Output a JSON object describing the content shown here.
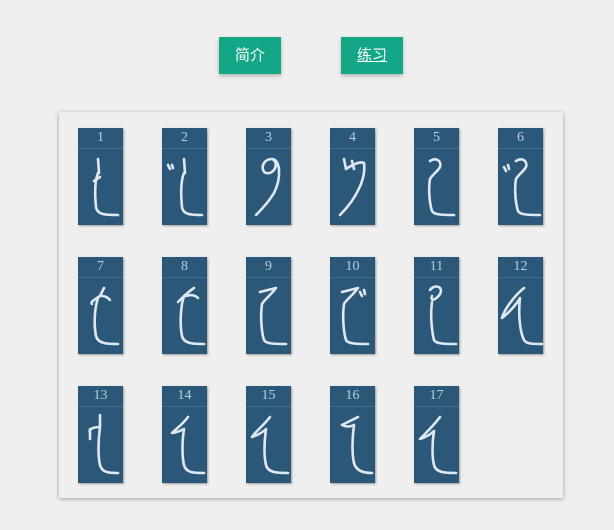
{
  "buttons": {
    "intro_label": "简介",
    "practice_label": "练习"
  },
  "colors": {
    "button_bg": "#14a787",
    "card_bg": "#2b5778",
    "page_bg": "#efefef"
  },
  "cards": [
    {
      "number": "1",
      "icon": "kana-stroke-1-icon"
    },
    {
      "number": "2",
      "icon": "kana-stroke-2-icon"
    },
    {
      "number": "3",
      "icon": "kana-stroke-3-icon"
    },
    {
      "number": "4",
      "icon": "kana-stroke-4-icon"
    },
    {
      "number": "5",
      "icon": "kana-stroke-5-icon"
    },
    {
      "number": "6",
      "icon": "kana-stroke-6-icon"
    },
    {
      "number": "7",
      "icon": "kana-stroke-7-icon"
    },
    {
      "number": "8",
      "icon": "kana-stroke-8-icon"
    },
    {
      "number": "9",
      "icon": "kana-stroke-9-icon"
    },
    {
      "number": "10",
      "icon": "kana-stroke-10-icon"
    },
    {
      "number": "11",
      "icon": "kana-stroke-11-icon"
    },
    {
      "number": "12",
      "icon": "kana-stroke-12-icon"
    },
    {
      "number": "13",
      "icon": "kana-stroke-13-icon"
    },
    {
      "number": "14",
      "icon": "kana-stroke-14-icon"
    },
    {
      "number": "15",
      "icon": "kana-stroke-15-icon"
    },
    {
      "number": "16",
      "icon": "kana-stroke-16-icon"
    },
    {
      "number": "17",
      "icon": "kana-stroke-17-icon"
    }
  ]
}
